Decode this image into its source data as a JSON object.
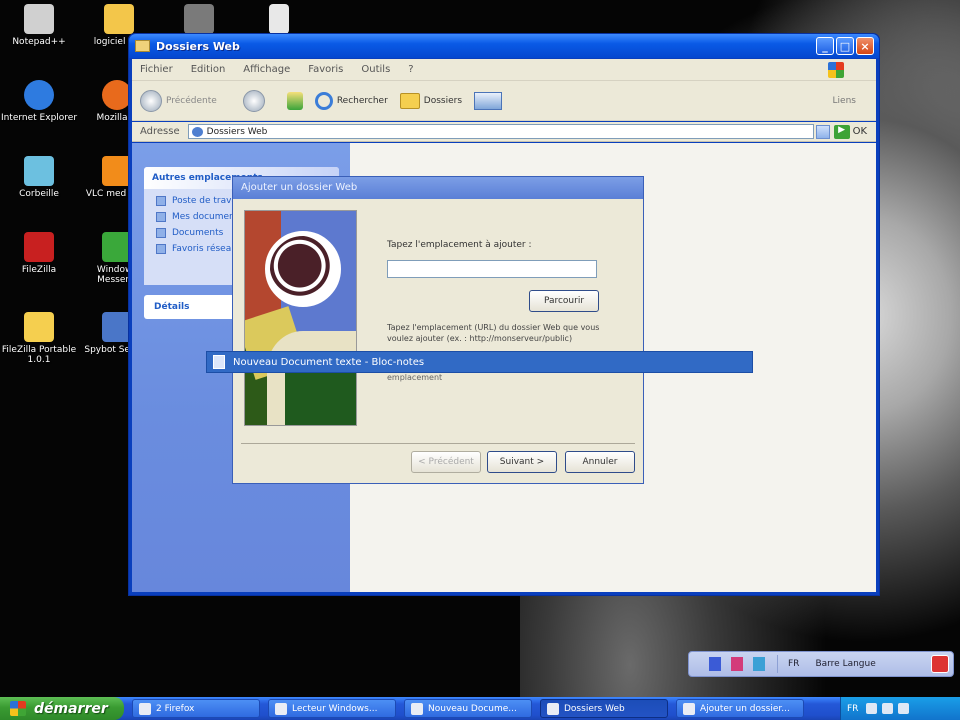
{
  "desktop": {
    "icons": [
      {
        "label": "Notepad++",
        "color": "#d0d0d0"
      },
      {
        "label": "logiciel zon",
        "color": "#f3c64a"
      },
      {
        "label": "",
        "color": "#7a7a7a"
      },
      {
        "label": "",
        "color": "#e8e8e8"
      },
      {
        "label": "Internet Explorer",
        "color": "#2e7be0"
      },
      {
        "label": "Mozilla Fi",
        "color": "#e86a1c"
      },
      {
        "label": "Corbeille",
        "color": "#6cc0e0"
      },
      {
        "label": "VLC med play",
        "color": "#f28c1a"
      },
      {
        "label": "FileZilla",
        "color": "#c82020"
      },
      {
        "label": "Windows Messeng",
        "color": "#3aa83a"
      },
      {
        "label": "FileZilla Portable 1.0.1",
        "color": "#f5cf4f"
      },
      {
        "label": "Spybot Search",
        "color": "#4a76c8"
      }
    ]
  },
  "explorer": {
    "title": "Dossiers Web",
    "window_controls": {
      "minimize": "_",
      "maximize": "□",
      "close": "×"
    },
    "menu": [
      "Fichier",
      "Edition",
      "Affichage",
      "Favoris",
      "Outils",
      "?"
    ],
    "toolbar": {
      "back_label": "Précédente",
      "search_label": "Rechercher",
      "folders_label": "Dossiers",
      "links_label": "Liens"
    },
    "address": {
      "label": "Adresse",
      "value": "Dossiers Web",
      "go_label": "OK"
    },
    "task_panel": {
      "heading": "Autres emplacements",
      "links": [
        "Poste de travail",
        "Mes documents",
        "Documents",
        "Favoris réseau"
      ]
    },
    "details_heading": "Détails"
  },
  "wizard": {
    "title": "Ajouter un dossier Web",
    "prompt_label": "Tapez l'emplacement à ajouter :",
    "location_value": "",
    "browse_label": "Parcourir",
    "help_text": "Tapez l'emplacement (URL) du dossier Web que vous voulez ajouter (ex. : http://monserveur/public)",
    "hidden_note": "emplacement",
    "buttons": {
      "back": "< Précédent",
      "next": "Suivant >",
      "cancel": "Annuler"
    }
  },
  "highlight_caption": "Nouveau Document texte - Bloc-notes",
  "language_bar": {
    "items": [
      "FR",
      "Barre Langue"
    ],
    "icon_colors": [
      "#3b5bd6",
      "#d33b7a",
      "#3aa0d6"
    ]
  },
  "taskbar": {
    "start_label": "démarrer",
    "buttons": [
      {
        "label": "2 Firefox",
        "active": false
      },
      {
        "label": "Lecteur Windows...",
        "active": false
      },
      {
        "label": "Nouveau Docume...",
        "active": false
      },
      {
        "label": "Dossiers Web",
        "active": true
      },
      {
        "label": "Ajouter un dossier...",
        "active": false
      }
    ],
    "tray_text": "FR"
  }
}
